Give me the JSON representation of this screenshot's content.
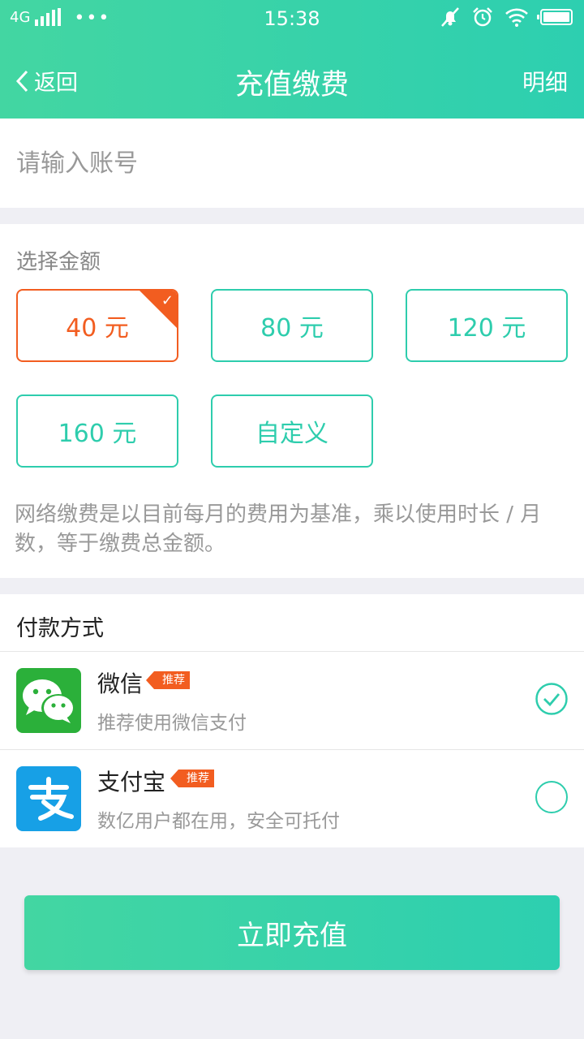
{
  "status_bar": {
    "network": "4G",
    "time": "15:38",
    "icons": [
      "signal-icon",
      "more-dots-icon",
      "mute-icon",
      "alarm-icon",
      "wifi-icon",
      "battery-icon"
    ]
  },
  "nav": {
    "back_label": "返回",
    "title": "充值缴费",
    "right_label": "明细"
  },
  "account": {
    "placeholder": "请输入账号",
    "value": ""
  },
  "amount": {
    "section_label": "选择金额",
    "options": [
      "40 元",
      "80 元",
      "120 元",
      "160 元",
      "自定义"
    ],
    "selected": "40 元",
    "note": "网络缴费是以目前每月的费用为基准，乘以使用时长 / 月数，等于缴费总金额。"
  },
  "payment": {
    "section_label": "付款方式",
    "methods": [
      {
        "name": "微信",
        "tag": "推荐",
        "desc": "推荐使用微信支付",
        "icon": "wechat-icon",
        "selected": true
      },
      {
        "name": "支付宝",
        "tag": "推荐",
        "desc": "数亿用户都在用，安全可托付",
        "icon": "alipay-icon",
        "selected": false
      }
    ]
  },
  "submit_label": "立即充值",
  "colors": {
    "primary": "#2ecdad",
    "accent": "#f25d20",
    "wechat": "#2bb03a",
    "alipay": "#17a0e6"
  }
}
